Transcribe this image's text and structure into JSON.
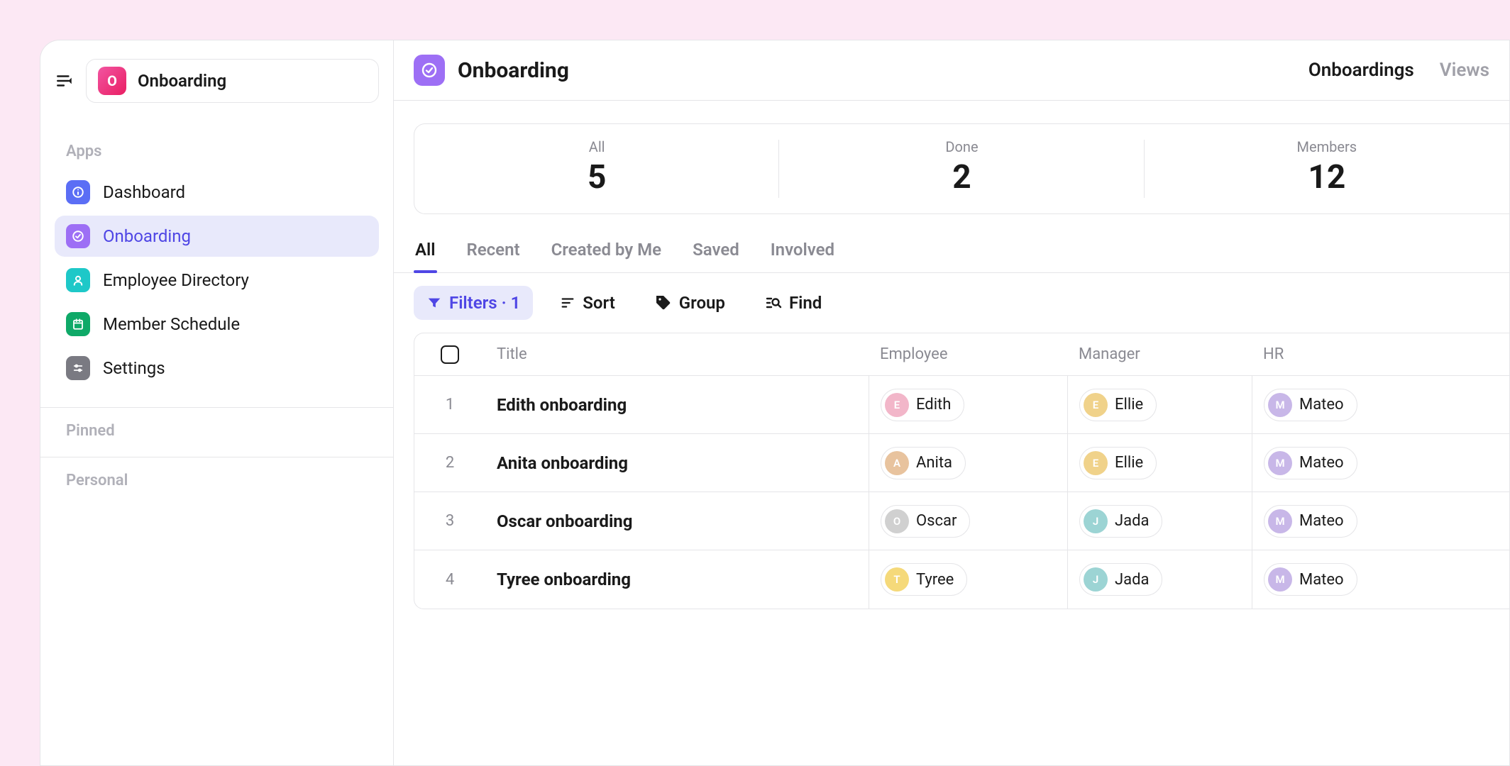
{
  "workspace": {
    "icon_letter": "O",
    "name": "Onboarding"
  },
  "sidebar": {
    "sections": {
      "apps": "Apps",
      "pinned": "Pinned",
      "personal": "Personal"
    },
    "items": [
      {
        "label": "Dashboard",
        "icon": "info",
        "color": "blue",
        "active": false
      },
      {
        "label": "Onboarding",
        "icon": "check",
        "color": "purple",
        "active": true
      },
      {
        "label": "Employee Directory",
        "icon": "user",
        "color": "teal",
        "active": false
      },
      {
        "label": "Member Schedule",
        "icon": "calendar",
        "color": "green",
        "active": false
      },
      {
        "label": "Settings",
        "icon": "sliders",
        "color": "gray",
        "active": false
      }
    ]
  },
  "header": {
    "title": "Onboarding",
    "tabs": [
      {
        "label": "Onboardings",
        "active": true
      },
      {
        "label": "Views",
        "active": false
      }
    ]
  },
  "stats": [
    {
      "label": "All",
      "value": "5"
    },
    {
      "label": "Done",
      "value": "2"
    },
    {
      "label": "Members",
      "value": "12"
    }
  ],
  "viewTabs": [
    {
      "label": "All",
      "active": true
    },
    {
      "label": "Recent",
      "active": false
    },
    {
      "label": "Created by Me",
      "active": false
    },
    {
      "label": "Saved",
      "active": false
    },
    {
      "label": "Involved",
      "active": false
    }
  ],
  "toolbar": {
    "filters": "Filters · 1",
    "sort": "Sort",
    "group": "Group",
    "find": "Find"
  },
  "table": {
    "columns": {
      "title": "Title",
      "employee": "Employee",
      "manager": "Manager",
      "hr": "HR"
    },
    "rows": [
      {
        "idx": "1",
        "title": "Edith onboarding",
        "employee": "Edith",
        "manager": "Ellie",
        "hr": "Mateo",
        "employee_color": "#f2b6c9",
        "manager_color": "#f0d28a",
        "hr_color": "#c8b7e8"
      },
      {
        "idx": "2",
        "title": "Anita onboarding",
        "employee": "Anita",
        "manager": "Ellie",
        "hr": "Mateo",
        "employee_color": "#e8c39e",
        "manager_color": "#f0d28a",
        "hr_color": "#c8b7e8"
      },
      {
        "idx": "3",
        "title": "Oscar onboarding",
        "employee": "Oscar",
        "manager": "Jada",
        "hr": "Mateo",
        "employee_color": "#d0d0d0",
        "manager_color": "#9cd4d4",
        "hr_color": "#c8b7e8"
      },
      {
        "idx": "4",
        "title": "Tyree onboarding",
        "employee": "Tyree",
        "manager": "Jada",
        "hr": "Mateo",
        "employee_color": "#f5d97a",
        "manager_color": "#9cd4d4",
        "hr_color": "#c8b7e8"
      }
    ]
  }
}
